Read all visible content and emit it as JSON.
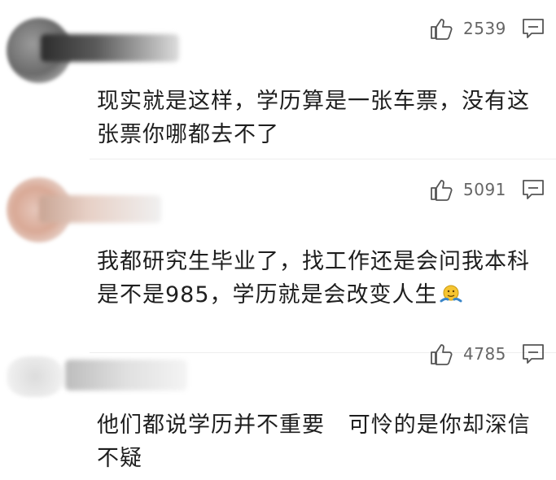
{
  "comments": [
    {
      "likes": "2539",
      "text": "现实就是这样，学历算是一张车票，没有这张票你哪都去不了"
    },
    {
      "likes": "5091",
      "text": "我都研究生毕业了，找工作还是会问我本科是不是985，学历就是会改变人生"
    },
    {
      "likes": "4785",
      "text": "他们都说学历并不重要   可怜的是你却深信不疑"
    }
  ],
  "icons": {
    "like": "thumbs-up-icon",
    "reply": "comment-icon",
    "emoji": "emoji-shrug-icon"
  },
  "colors": {
    "text": "#1e1e1e",
    "meta": "#666666",
    "divider": "#eeeeee"
  }
}
